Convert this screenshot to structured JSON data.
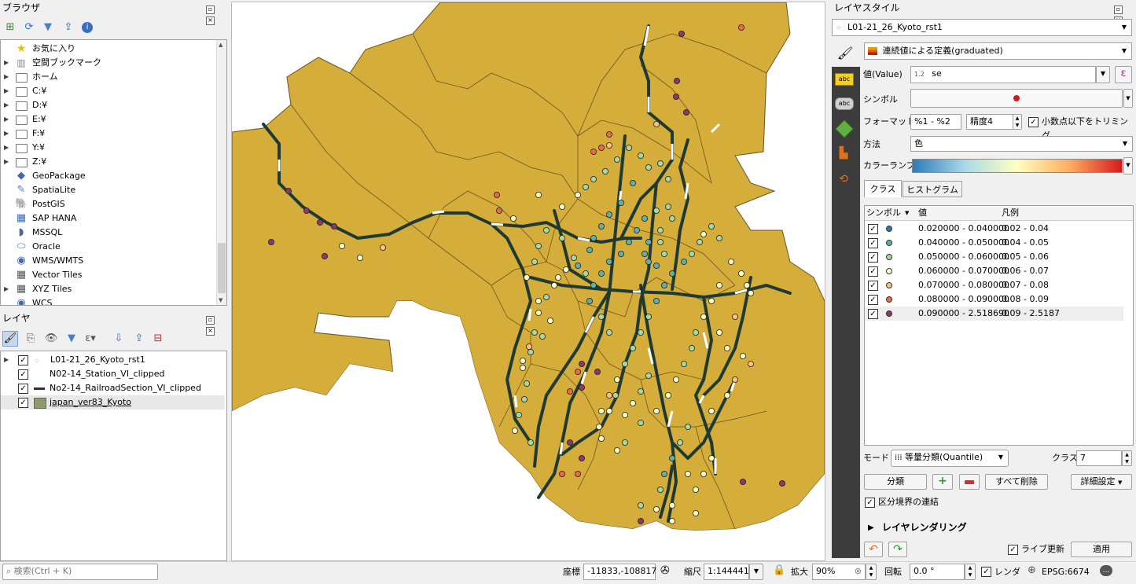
{
  "browser": {
    "title": "ブラウザ",
    "items": [
      {
        "label": "お気に入り",
        "icon": "star-icon",
        "expand": false
      },
      {
        "label": "空間ブックマーク",
        "icon": "bookmark-icon",
        "expand": true
      },
      {
        "label": "ホーム",
        "icon": "folder-icon",
        "expand": true
      },
      {
        "label": "C:¥",
        "icon": "folder-icon",
        "expand": true
      },
      {
        "label": "D:¥",
        "icon": "folder-icon",
        "expand": true
      },
      {
        "label": "E:¥",
        "icon": "folder-icon",
        "expand": true
      },
      {
        "label": "F:¥",
        "icon": "folder-icon",
        "expand": true
      },
      {
        "label": "Y:¥",
        "icon": "folder-icon",
        "expand": true
      },
      {
        "label": "Z:¥",
        "icon": "folder-icon",
        "expand": true
      },
      {
        "label": "GeoPackage",
        "icon": "geopackage-icon",
        "expand": false
      },
      {
        "label": "SpatiaLite",
        "icon": "spatialite-icon",
        "expand": false
      },
      {
        "label": "PostGIS",
        "icon": "postgis-icon",
        "expand": false
      },
      {
        "label": "SAP HANA",
        "icon": "saphana-icon",
        "expand": false
      },
      {
        "label": "MSSQL",
        "icon": "mssql-icon",
        "expand": false
      },
      {
        "label": "Oracle",
        "icon": "oracle-icon",
        "expand": false
      },
      {
        "label": "WMS/WMTS",
        "icon": "wms-icon",
        "expand": false
      },
      {
        "label": "Vector Tiles",
        "icon": "vector-tiles-icon",
        "expand": false
      },
      {
        "label": "XYZ Tiles",
        "icon": "xyz-tiles-icon",
        "expand": true
      },
      {
        "label": "WCS",
        "icon": "wcs-icon",
        "expand": false
      }
    ]
  },
  "layers": {
    "title": "レイヤ",
    "items": [
      {
        "label": "L01-21_26_Kyoto_rst1",
        "checked": true,
        "expand": true,
        "icon": "point-layer-icon"
      },
      {
        "label": "N02-14_Station_VI_clipped",
        "checked": true,
        "expand": false,
        "icon": "none"
      },
      {
        "label": "No2-14_RailroadSection_VI_clipped",
        "checked": true,
        "expand": false,
        "icon": "line-layer-icon"
      },
      {
        "label": "japan_ver83_Kyoto",
        "checked": true,
        "expand": false,
        "icon": "polygon-layer-icon"
      }
    ]
  },
  "style": {
    "title": "レイヤスタイル",
    "layer_select": "L01-21_26_Kyoto_rst1",
    "renderer": "連続値による定義(graduated)",
    "value_label": "値(Value)",
    "value_prefix": "1.2",
    "value": "se",
    "symbol_label": "シンボル",
    "format_label": "フォーマット",
    "format_value": "%1 - %2",
    "precision": "精度4",
    "trim_label": "小数点以下をトリミング",
    "method_label": "方法",
    "method_value": "色",
    "ramp_label": "カラーランプ",
    "tab_classes": "クラス",
    "tab_histogram": "ヒストグラム",
    "col_symbol": "シンボル",
    "col_value": "値",
    "col_legend": "凡例",
    "classes": [
      {
        "value": "0.020000 - 0.040000",
        "legend": "0.02 - 0.04",
        "color": "#2c7bb6"
      },
      {
        "value": "0.040000 - 0.050000",
        "legend": "0.04 - 0.05",
        "color": "#5fb0a8"
      },
      {
        "value": "0.050000 - 0.060000",
        "legend": "0.05 - 0.06",
        "color": "#a6d9a0"
      },
      {
        "value": "0.060000 - 0.070000",
        "legend": "0.06 - 0.07",
        "color": "#fbfbc2"
      },
      {
        "value": "0.070000 - 0.080000",
        "legend": "0.07 - 0.08",
        "color": "#fdbf82"
      },
      {
        "value": "0.080000 - 0.090000",
        "legend": "0.08 - 0.09",
        "color": "#ec6a4a"
      },
      {
        "value": "0.090000 - 2.518690",
        "legend": "0.09 - 2.5187",
        "color": "#8a3a6a"
      }
    ],
    "mode_label": "モード",
    "mode_value": "等量分類(Quantile)",
    "classes_label": "クラス",
    "classes_count": "7",
    "classify_btn": "分類",
    "delete_all_btn": "すべて削除",
    "advanced_btn": "詳細設定",
    "link_bounds": "区分境界の連結",
    "rendering": "レイヤレンダリング",
    "live_update": "ライブ更新",
    "apply_btn": "適用"
  },
  "status": {
    "search_placeholder": "検索(Ctrl + K)",
    "coord_label": "座標",
    "coord_value": "-11833,-108817",
    "scale_label": "縮尺",
    "scale_value": "1:144441",
    "magnifier_label": "拡大",
    "magnifier_value": "90%",
    "rotation_label": "回転",
    "rotation_value": "0.0 °",
    "render_label": "レンダ",
    "crs": "EPSG:6674"
  },
  "colors": {
    "map_fill": "#d4ad3a",
    "map_stroke": "#6b5320",
    "rail": "#1f3a33",
    "ramp_start": "#2c7bb6",
    "ramp_end": "#d7191c"
  }
}
